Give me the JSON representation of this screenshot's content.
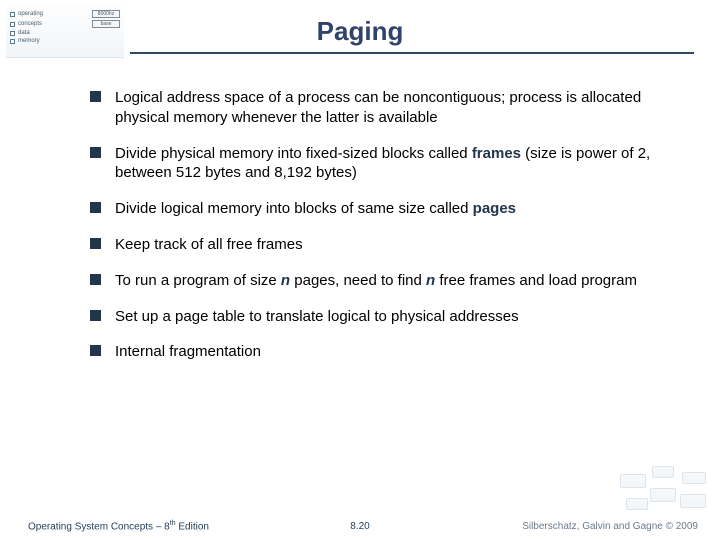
{
  "title": "Paging",
  "bullets": [
    {
      "html": "Logical address space of a process can be noncontiguous; process is allocated physical memory whenever the latter is available"
    },
    {
      "html": "Divide physical memory into fixed-sized blocks called <span class='kw-strong'>frames</span> (size is power of 2, between 512 bytes and 8,192 bytes)"
    },
    {
      "html": "Divide logical memory into blocks of same size called <span class='kw-strong'>pages</span>"
    },
    {
      "html": "Keep track of all free frames"
    },
    {
      "html": "To run a program of size <span class='kw-em'>n</span> pages, need to find <span class='kw-em'>n</span> free frames and load program"
    },
    {
      "html": "Set up a page table to translate logical to physical addresses"
    },
    {
      "html": "Internal fragmentation"
    }
  ],
  "footer": {
    "left": "Operating System Concepts – 8<sup>th</sup> Edition",
    "center": "8.20",
    "right": "Silberschatz, Galvin and Gagne © 2009"
  },
  "thumb": {
    "rows": [
      "operating",
      "concepts",
      "data",
      "memory"
    ],
    "boxes": [
      "8000hz",
      "base"
    ]
  }
}
